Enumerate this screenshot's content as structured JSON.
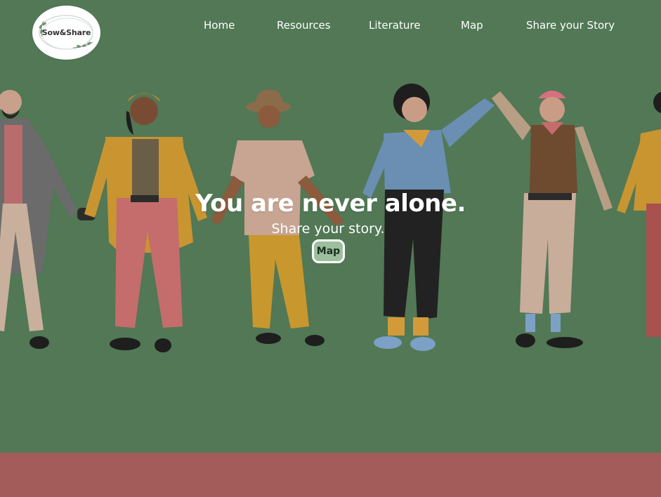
{
  "brand": {
    "logo_text": "Sow&Share"
  },
  "nav": {
    "items": [
      {
        "label": "Home"
      },
      {
        "label": "Resources"
      },
      {
        "label": "Literature"
      },
      {
        "label": "Map"
      },
      {
        "label": "Share your Story"
      }
    ]
  },
  "hero": {
    "title": "You are never alone.",
    "subtitle": "Share your story.",
    "button_label": "Map"
  },
  "colors": {
    "background": "#527856",
    "footer_band": "#a45c5b",
    "button_fill": "#9cbf9e"
  }
}
